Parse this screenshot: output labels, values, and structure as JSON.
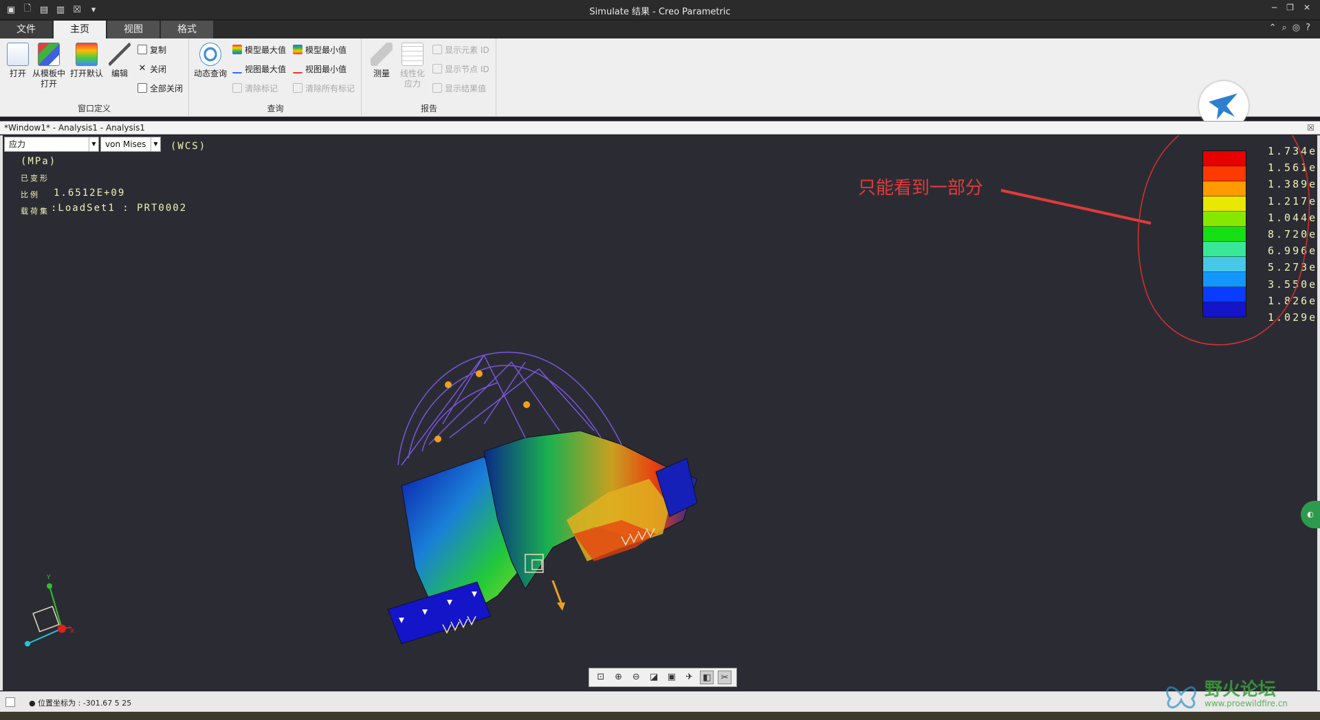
{
  "window": {
    "title": "Simulate 结果 - Creo Parametric"
  },
  "tabs": [
    {
      "label": "文件"
    },
    {
      "label": "主页"
    },
    {
      "label": "视图"
    },
    {
      "label": "格式"
    }
  ],
  "ribbon": {
    "window_group": {
      "label": "窗口定义",
      "open": "打开",
      "open_from_template": "从模板中打开",
      "open_default": "打开默认",
      "edit": "编辑",
      "copy": "复制",
      "close": "关闭",
      "close_all": "全部关闭"
    },
    "query_group": {
      "label": "查询",
      "dynamic_query": "动态查询",
      "model_max": "模型最大值",
      "model_min": "模型最小值",
      "view_max": "视图最大值",
      "view_min": "视图最小值",
      "clear_marks": "清除标记",
      "clear_all_marks": "清除所有标记"
    },
    "report_group": {
      "label": "报告",
      "measure": "测量",
      "linearized_stress": "线性化应力",
      "show_element_id": "显示元素 ID",
      "show_node_id": "显示节点 ID",
      "show_result_value": "显示结果值"
    }
  },
  "viewport": {
    "title": "*Window1* - Analysis1 - Analysis1",
    "quantity_select": "应力",
    "component_select": "von Mises",
    "coord_label": "(WCS)",
    "units": "(MPa)",
    "deformed": "已变形",
    "scale_label": "比例",
    "scale_value": "1.6512E+09",
    "loadset_label": "载荷集",
    "loadset_value": ":LoadSet1 :  PRT0002",
    "legend_values": [
      "1.734e",
      "1.561e",
      "1.389e",
      "1.217e",
      "1.044e",
      "8.720e",
      "6.996e",
      "5.273e",
      "3.550e",
      "1.826e",
      "1.029e"
    ],
    "legend_colors": [
      "#e60000",
      "#ff3a00",
      "#ff9a00",
      "#e8e800",
      "#86e800",
      "#14e014",
      "#38e898",
      "#48c8e8",
      "#1496ff",
      "#0a3cff",
      "#1414c8"
    ],
    "annotation": "只能看到一部分"
  },
  "statusbar": {
    "message": "● 位置坐标为 : -301.67  5  25"
  },
  "watermark": {
    "title": "野火论坛",
    "url": "www.proewildfire.cn"
  }
}
